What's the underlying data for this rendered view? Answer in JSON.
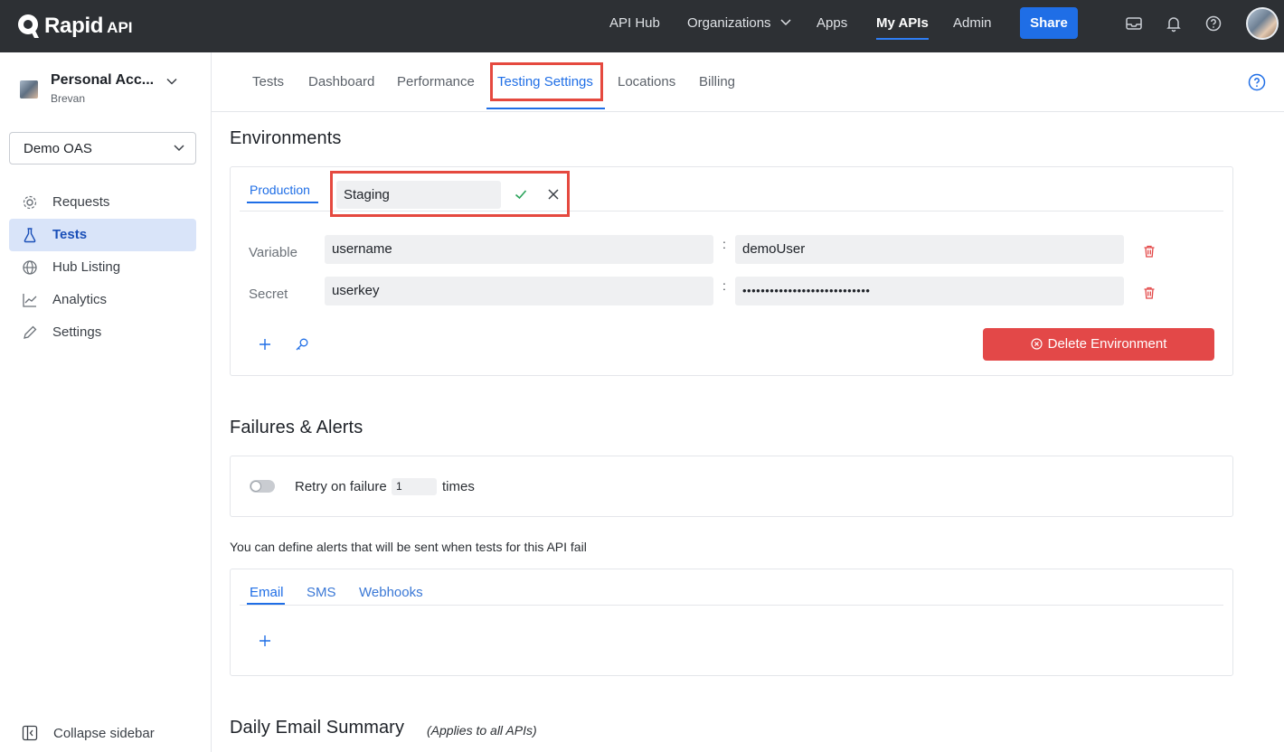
{
  "brand": {
    "name": "Rapid",
    "suffix": "API"
  },
  "topnav": {
    "items": [
      "API Hub",
      "Organizations",
      "Apps",
      "My APIs",
      "Admin"
    ],
    "active": "My APIs",
    "share_label": "Share"
  },
  "sidebar": {
    "account_name": "Personal Acc...",
    "account_user": "Brevan",
    "api_selected": "Demo OAS",
    "items": [
      {
        "label": "Requests",
        "icon": "requests-icon"
      },
      {
        "label": "Tests",
        "icon": "flask-icon"
      },
      {
        "label": "Hub Listing",
        "icon": "globe-icon"
      },
      {
        "label": "Analytics",
        "icon": "chart-icon"
      },
      {
        "label": "Settings",
        "icon": "pencil-icon"
      }
    ],
    "active_item": "Tests",
    "collapse_label": "Collapse sidebar"
  },
  "tabs": {
    "items": [
      "Tests",
      "Dashboard",
      "Performance",
      "Testing Settings",
      "Locations",
      "Billing"
    ],
    "active": "Testing Settings"
  },
  "environments": {
    "title": "Environments",
    "tab_production": "Production",
    "new_env_value": "Staging",
    "rows": [
      {
        "label": "Variable",
        "key": "username",
        "value": "demoUser"
      },
      {
        "label": "Secret",
        "key": "userkey",
        "value": "••••••••••••••••••••••••••••"
      }
    ],
    "delete_label": "Delete Environment"
  },
  "failures": {
    "title": "Failures & Alerts",
    "retry_label": "Retry on failure",
    "retry_value": "1",
    "retry_suffix": "times",
    "alerts_intro": "You can define alerts that will be sent when tests for this API fail",
    "alert_tabs": [
      "Email",
      "SMS",
      "Webhooks"
    ],
    "active_alert_tab": "Email"
  },
  "daily": {
    "title": "Daily Email Summary",
    "subtitle": "(Applies to all APIs)"
  },
  "colors": {
    "topbar": "#2d3034",
    "accent": "#1f6ee6",
    "danger": "#e34848",
    "highlight": "#e5493f",
    "success": "#2aa35a"
  }
}
